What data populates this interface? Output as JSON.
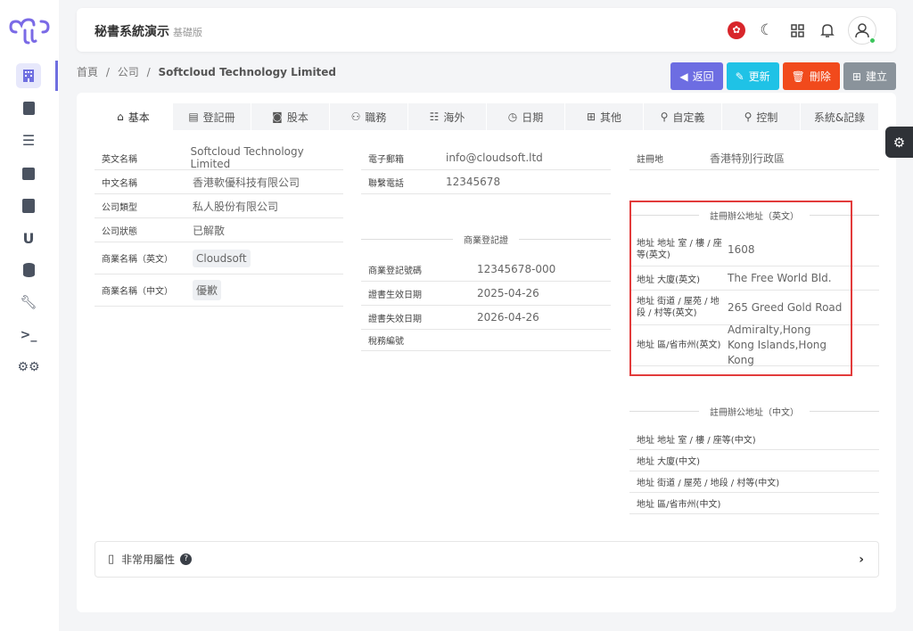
{
  "app": {
    "title": "秘書系統演示",
    "subtitle": "基礎版"
  },
  "sidebar": {
    "items": [
      "company-icon",
      "contact-icon",
      "list-icon",
      "calendar-icon",
      "book-icon",
      "magnet-icon",
      "database-icon",
      "wrench-icon",
      "terminal-icon",
      "gears-icon"
    ]
  },
  "breadcrumb": {
    "home": "首頁",
    "section": "公司",
    "current": "Softcloud Technology Limited",
    "sep": "/"
  },
  "actions": {
    "back": "返回",
    "update": "更新",
    "delete": "刪除",
    "create": "建立"
  },
  "colors": {
    "back": "#6d6de2",
    "update": "#1fc2e6",
    "delete": "#f14a1c",
    "create": "#8a939b",
    "accent": "#6f6fe0",
    "highlight": "#e23b3b"
  },
  "tabs": [
    "基本",
    "登記冊",
    "股本",
    "職務",
    "海外",
    "日期",
    "其他",
    "自定義",
    "控制",
    "系統&記錄"
  ],
  "basic": [
    {
      "label": "英文名稱",
      "value": "Softcloud Technology Limited"
    },
    {
      "label": "中文名稱",
      "value": "香港軟優科技有限公司"
    },
    {
      "label": "公司類型",
      "value": "私人股份有限公司"
    },
    {
      "label": "公司狀態",
      "value": "已解散"
    },
    {
      "label": "商業名稱（英文）",
      "value": "Cloudsoft"
    },
    {
      "label": "商業名稱（中文）",
      "value": "優歉"
    }
  ],
  "contact": [
    {
      "label": "電子郵箱",
      "value": "info@cloudsoft.ltd"
    },
    {
      "label": "聯繫電話",
      "value": "12345678"
    }
  ],
  "br": {
    "title": "商業登記證",
    "rows": [
      {
        "label": "商業登記號碼",
        "value": "12345678-000"
      },
      {
        "label": "證書生效日期",
        "value": "2025-04-26"
      },
      {
        "label": "證書失效日期",
        "value": "2026-04-26"
      },
      {
        "label": "稅務編號",
        "value": ""
      }
    ]
  },
  "registration": {
    "label": "註冊地",
    "value": "香港特別行政區"
  },
  "office_en": {
    "title": "註冊辦公地址（英文）",
    "rows": [
      {
        "label": "地址 地址 室 / 樓 / 座等(英文)",
        "value": "1608"
      },
      {
        "label": "地址 大廈(英文)",
        "value": "The Free World Bld."
      },
      {
        "label": "地址 街道 / 屋苑 / 地段 / 村等(英文)",
        "value": "265 Greed Gold Road"
      },
      {
        "label": "地址 區/省市州(英文)",
        "value": "Admiralty,Hong Kong Islands,Hong Kong"
      }
    ]
  },
  "office_zh": {
    "title": "註冊辦公地址（中文）",
    "rows": [
      {
        "label": "地址 地址 室 / 樓 / 座等(中文)",
        "value": ""
      },
      {
        "label": "地址 大廈(中文)",
        "value": ""
      },
      {
        "label": "地址 街道 / 屋苑 / 地段 / 村等(中文)",
        "value": ""
      },
      {
        "label": "地址 區/省市州(中文)",
        "value": ""
      }
    ]
  },
  "rare": {
    "label": "非常用屬性"
  }
}
